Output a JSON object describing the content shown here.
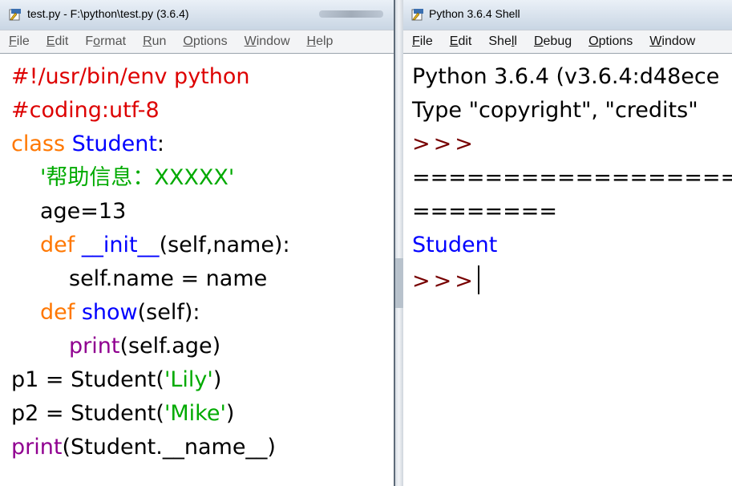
{
  "editor": {
    "title": "test.py - F:\\python\\test.py (3.6.4)",
    "menu": [
      {
        "u": "F",
        "rest": "ile"
      },
      {
        "u": "E",
        "rest": "dit"
      },
      {
        "pre": "F",
        "u": "o",
        "rest": "rmat"
      },
      {
        "u": "R",
        "rest": "un"
      },
      {
        "u": "O",
        "rest": "ptions"
      },
      {
        "u": "W",
        "rest": "indow"
      },
      {
        "u": "H",
        "rest": "elp"
      }
    ],
    "code": {
      "l1": "#!/usr/bin/env python",
      "l2": "#coding:utf-8",
      "l3_kw": "class",
      "l3_name": "Student",
      "l3_colon": ":",
      "l4": "'帮助信息：XXXXX'",
      "l5": "age=13",
      "l6_kw": "def",
      "l6_name": "__init__",
      "l6_rest": "(self,name):",
      "l7": "self.name = name",
      "l8_kw": "def",
      "l8_name": "show",
      "l8_rest": "(self):",
      "l9_bi": "print",
      "l9_rest": "(self.age)",
      "l10_a": "p1 = Student(",
      "l10_str": "'Lily'",
      "l10_b": ")",
      "l11_a": "p2 = Student(",
      "l11_str": "'Mike'",
      "l11_b": ")",
      "l12_bi": "print",
      "l12_rest": "(Student.__name__)"
    }
  },
  "shell": {
    "title": "Python 3.6.4 Shell",
    "menu": [
      {
        "u": "F",
        "rest": "ile"
      },
      {
        "u": "E",
        "rest": "dit"
      },
      {
        "pre": "She",
        "u": "l",
        "rest": "l"
      },
      {
        "u": "D",
        "rest": "ebug"
      },
      {
        "u": "O",
        "rest": "ptions"
      },
      {
        "u": "W",
        "rest": "indow"
      }
    ],
    "lines": {
      "l1": "Python 3.6.4 (v3.6.4:d48ece",
      "l2": "Type \"copyright\", \"credits\"",
      "l3": ">>>",
      "l4": "==================",
      "l5": "========",
      "l6": "Student",
      "l7": ">>>"
    }
  },
  "colors": {
    "keyword": "#ff7700",
    "definition": "#0000ff",
    "comment": "#dd0000",
    "string": "#00aa00",
    "builtin": "#900090",
    "prompt": "#770000",
    "stdout": "#0000ff"
  },
  "icons": {
    "window_icon": "python-idle-icon"
  }
}
